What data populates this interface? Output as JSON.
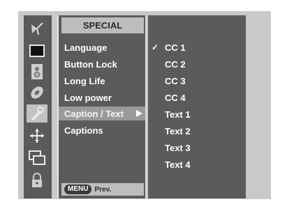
{
  "icons": [
    {
      "name": "antenna-icon",
      "selected": false
    },
    {
      "name": "screen-icon",
      "selected": false
    },
    {
      "name": "speaker-icon",
      "selected": false
    },
    {
      "name": "disc-icon",
      "selected": false
    },
    {
      "name": "special-tool-icon",
      "selected": true
    },
    {
      "name": "move-icon",
      "selected": false
    },
    {
      "name": "pip-icon",
      "selected": false
    },
    {
      "name": "lock-icon",
      "selected": false
    }
  ],
  "menu": {
    "title": "SPECIAL",
    "items": [
      {
        "label": "Language"
      },
      {
        "label": "Button Lock"
      },
      {
        "label": "Long Life"
      },
      {
        "label": "Low power"
      },
      {
        "label": "Caption / Text",
        "selected": true
      },
      {
        "label": "Captions"
      }
    ],
    "footer_button": "MENU",
    "footer_label": "Prev."
  },
  "submenu": {
    "items": [
      {
        "label": "CC 1",
        "checked": true
      },
      {
        "label": "CC 2"
      },
      {
        "label": "CC 3"
      },
      {
        "label": "CC 4"
      },
      {
        "label": "Text 1"
      },
      {
        "label": "Text 2"
      },
      {
        "label": "Text 3"
      },
      {
        "label": "Text 4"
      }
    ],
    "check_glyph": "✓"
  },
  "colors": {
    "panel": "#5b5b5b",
    "highlight": "#9a9a9a",
    "title_bar": "#bdbdbd",
    "frame": "#c9c9c9"
  }
}
